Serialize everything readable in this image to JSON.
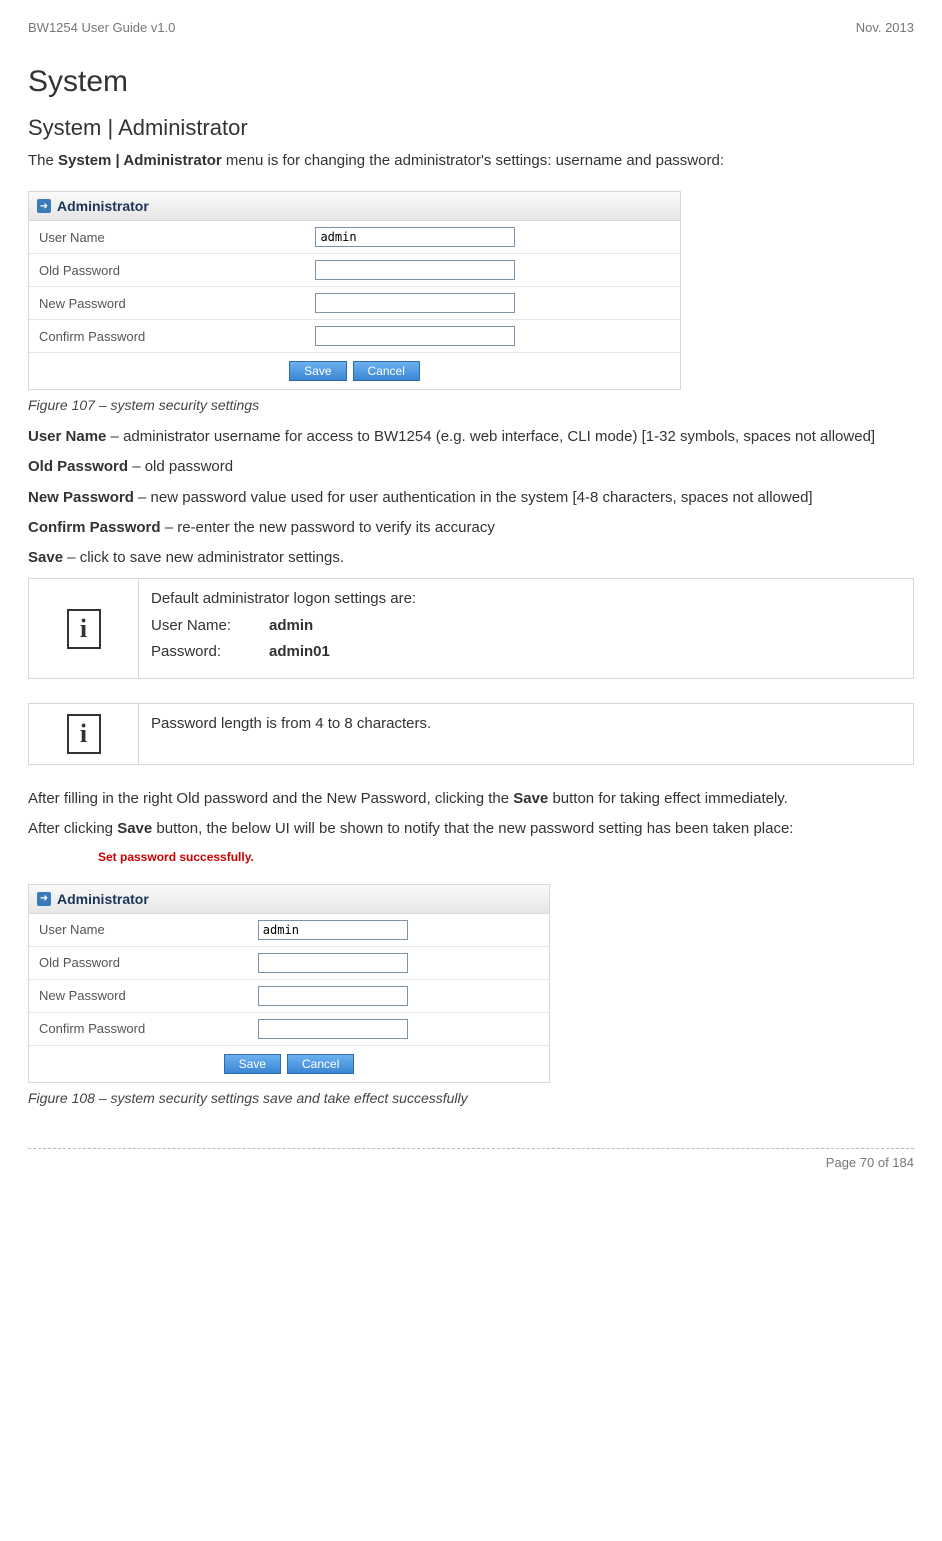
{
  "header": {
    "left": "BW1254 User Guide v1.0",
    "right": "Nov.  2013"
  },
  "h1": "System",
  "h2": "System | Administrator",
  "intro": {
    "pre": "The ",
    "bold": "System | Administrator",
    "post": " menu is for changing the administrator's settings: username and password:"
  },
  "panel1": {
    "title": "Administrator",
    "rows": {
      "username_label": "User Name",
      "username_value": "admin",
      "oldpw_label": "Old Password",
      "newpw_label": "New Password",
      "confirm_label": "Confirm Password"
    },
    "buttons": {
      "save": "Save",
      "cancel": "Cancel"
    }
  },
  "caption1": "Figure 107 – system security settings",
  "defs": {
    "username": {
      "term": "User Name",
      "text": " – administrator username for access to BW1254 (e.g. web interface, CLI mode) [1-32 symbols, spaces not allowed]"
    },
    "oldpw": {
      "term": "Old Password",
      "text": " – old password"
    },
    "newpw": {
      "term": "New Password",
      "text": " – new password value used for user authentication in the system [4-8 characters, spaces not allowed]"
    },
    "confirm": {
      "term": "Confirm Password",
      "text": " – re-enter the new password to verify its accuracy"
    },
    "save": {
      "term": "Save",
      "text": " – click to save new administrator settings."
    }
  },
  "info1": {
    "line1": "Default administrator logon settings are:",
    "user_k": "User Name:",
    "user_v": "admin",
    "pass_k": "Password:",
    "pass_v": "admin01"
  },
  "info2": {
    "text": "Password length is from 4 to 8 characters."
  },
  "after1": {
    "pre": "After filling in the right Old password and the New Password, clicking the ",
    "bold": "Save",
    "post": " button for taking effect immediately."
  },
  "after2": {
    "pre": "After clicking ",
    "bold": "Save",
    "post": " button, the below UI will be shown to notify that the new password setting has been taken place:"
  },
  "success_msg": "Set password successfully.",
  "caption2": "Figure 108 – system security settings save and take effect successfully",
  "footer": "Page 70 of 184",
  "icon_glyph": "i"
}
